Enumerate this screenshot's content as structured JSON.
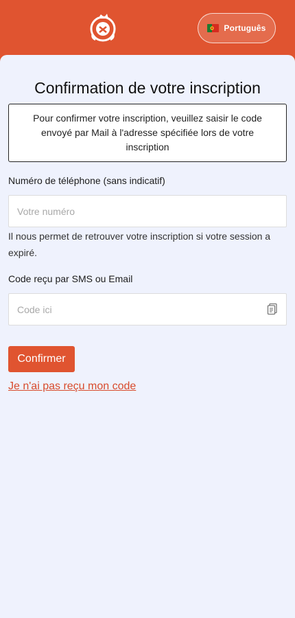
{
  "header": {
    "language_label": "Português",
    "language_flag": "portugal-flag-icon",
    "accent_color": "#e05430"
  },
  "main": {
    "title": "Confirmation de votre inscription",
    "info_text": "Pour confirmer votre inscription, veuillez saisir le code envoyé par Mail à l'adresse spécifiée lors de votre inscription",
    "phone_label": "Numéro de téléphone (sans indicatif)",
    "phone_placeholder": "Votre numéro",
    "phone_help": "Il nous permet de retrouver votre inscription si votre session a expiré.",
    "code_label": "Code reçu par SMS ou Email",
    "code_placeholder": "Code ici",
    "paste_icon": "clipboard-paste-icon",
    "confirm_label": "Confirmer",
    "resend_link": "Je n'ai pas reçu mon code"
  }
}
